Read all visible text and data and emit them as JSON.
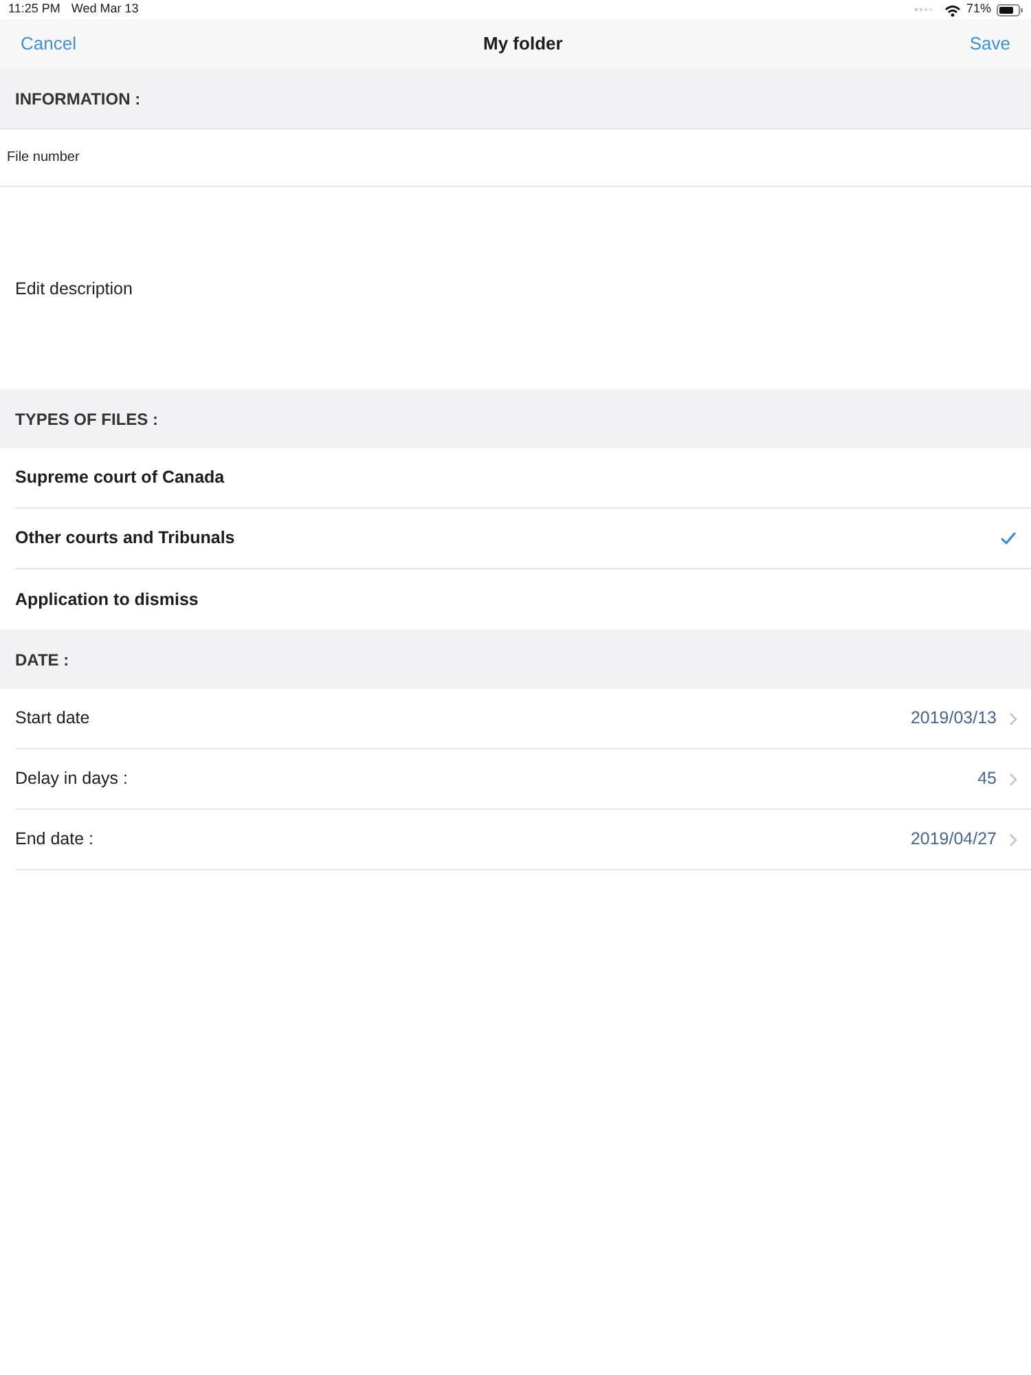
{
  "status_bar": {
    "time": "11:25 PM",
    "date": "Wed Mar 13",
    "battery": "71%"
  },
  "nav_bar": {
    "cancel": "Cancel",
    "title": "My folder",
    "save": "Save"
  },
  "sections": [
    {
      "kind": "fields",
      "header": "INFORMATION :",
      "fields": [
        {
          "kind": "input",
          "placeholder": "File number"
        },
        {
          "kind": "textarea",
          "placeholder": "Edit description"
        }
      ]
    },
    {
      "kind": "choices",
      "header": "TYPES OF FILES :",
      "items": [
        {
          "label": "Supreme court of Canada",
          "selected": false
        },
        {
          "label": "Other courts and Tribunals",
          "selected": true
        },
        {
          "label": "Application to dismiss",
          "selected": false
        }
      ]
    },
    {
      "kind": "details",
      "header": "DATE :",
      "rows": [
        {
          "label": "Start date",
          "value": "2019/03/13"
        },
        {
          "label": "Delay in days :",
          "value": "45"
        },
        {
          "label": "End date :",
          "value": "2019/04/27"
        }
      ]
    }
  ]
}
